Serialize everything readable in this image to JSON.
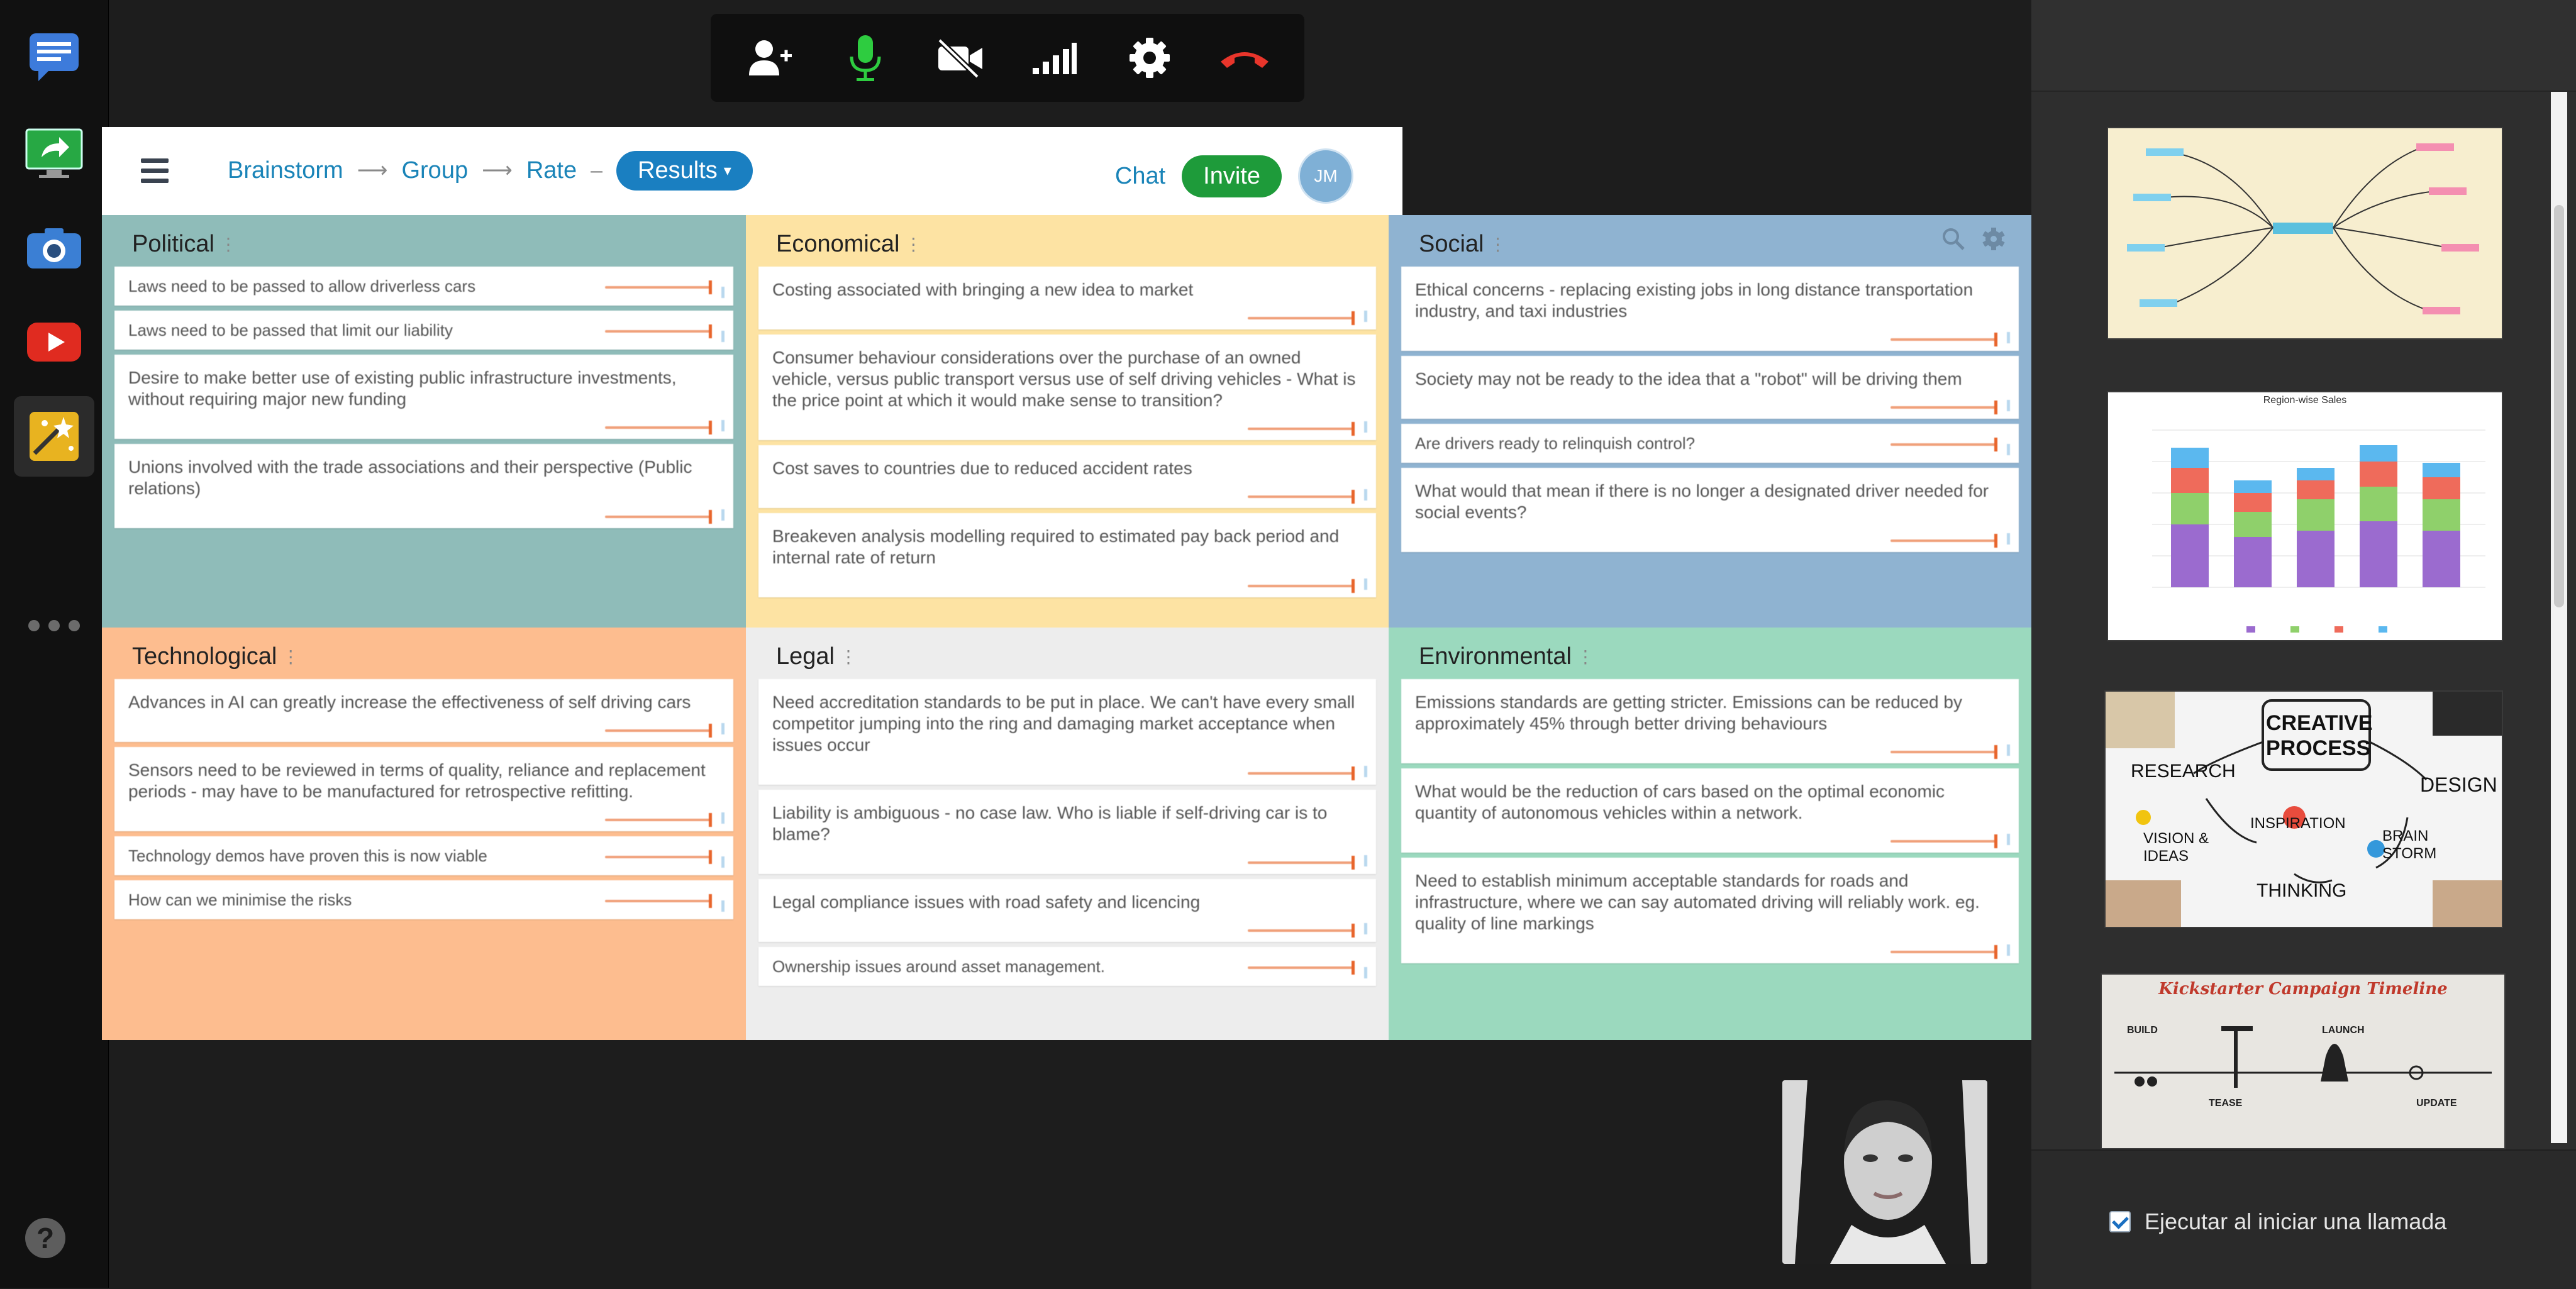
{
  "dock": {
    "items": [
      {
        "name": "chat-icon",
        "color": "#3d7bdb"
      },
      {
        "name": "screen-share-icon",
        "color": "#27a844"
      },
      {
        "name": "camera-icon",
        "color": "#3b7fd4"
      },
      {
        "name": "youtube-icon",
        "color": "#e02b20"
      },
      {
        "name": "photo-effects-icon",
        "color": "#e8b320"
      }
    ],
    "help_label": "?"
  },
  "callbar": {
    "buttons": [
      "add-person-icon",
      "microphone-icon",
      "video-off-icon",
      "signal-icon",
      "settings-icon",
      "hang-up-icon"
    ]
  },
  "header": {
    "breadcrumbs": [
      "Brainstorm",
      "Group",
      "Rate"
    ],
    "active_step": "Results",
    "chat_label": "Chat",
    "invite_label": "Invite",
    "avatar_initials": "JM"
  },
  "categories": [
    {
      "title": "Political",
      "color": "#8fbcb9",
      "cards": [
        {
          "text": "Laws need to be passed to allow driverless cars",
          "size": "small"
        },
        {
          "text": "Laws need to be passed that limit our liability",
          "size": "small"
        },
        {
          "text": "Desire to make better use of existing public infrastructure investments, without requiring major new funding",
          "size": "normal"
        },
        {
          "text": "Unions involved with the trade associations and their perspective (Public relations)",
          "size": "normal"
        }
      ]
    },
    {
      "title": "Economical",
      "color": "#fde3a3",
      "cards": [
        {
          "text": "Costing associated with bringing a new idea to market",
          "size": "normal"
        },
        {
          "text": "Consumer behaviour considerations over the purchase of an owned vehicle, versus public transport versus use of self driving vehicles - What is the price point at which it would make sense to transition?",
          "size": "normal"
        },
        {
          "text": "Cost saves to countries due to reduced accident rates",
          "size": "normal"
        },
        {
          "text": "Breakeven analysis modelling required to estimated pay back period and internal rate of return",
          "size": "normal"
        }
      ]
    },
    {
      "title": "Social",
      "color": "#8fb3d1",
      "cards": [
        {
          "text": "Ethical concerns - replacing existing jobs in long distance transportation industry, and taxi industries",
          "size": "normal"
        },
        {
          "text": "Society may not be ready to the idea that a \"robot\" will be driving them",
          "size": "normal"
        },
        {
          "text": "Are drivers ready to relinquish control?",
          "size": "small"
        },
        {
          "text": "What would that mean if there is no longer a designated driver needed for social events?",
          "size": "normal"
        }
      ]
    },
    {
      "title": "Technological",
      "color": "#fdbd8f",
      "cards": [
        {
          "text": "Advances in AI can greatly increase the effectiveness of self driving cars",
          "size": "normal"
        },
        {
          "text": "Sensors need to be reviewed in terms of quality, reliance and replacement periods - may have to be manufactured for retrospective refitting.",
          "size": "normal"
        },
        {
          "text": "Technology demos have proven this is now viable",
          "size": "small"
        },
        {
          "text": "How can we minimise the risks",
          "size": "small"
        }
      ]
    },
    {
      "title": "Legal",
      "color": "#ededed",
      "cards": [
        {
          "text": "Need accreditation standards to be put in place. We can't have every small competitor jumping into the ring and damaging market acceptance when issues occur",
          "size": "normal"
        },
        {
          "text": "Liability is ambiguous - no case law. Who is liable if self-driving car is to blame?",
          "size": "normal"
        },
        {
          "text": "Legal compliance issues with road safety and licencing",
          "size": "normal"
        },
        {
          "text": "Ownership issues around asset management.",
          "size": "small"
        }
      ]
    },
    {
      "title": "Environmental",
      "color": "#9bd9be",
      "cards": [
        {
          "text": "Emissions standards are getting stricter. Emissions can be reduced by approximately 45% through better driving behaviours",
          "size": "normal"
        },
        {
          "text": "What would be the reduction of cars based on the optimal economic quantity of autonomous vehicles within a network.",
          "size": "normal"
        },
        {
          "text": "Need to establish minimum acceptable standards for roads and infrastructure, where we can say automated driving will reliably work. eg. quality of line markings",
          "size": "normal"
        }
      ]
    }
  ],
  "side_panel": {
    "thumbnails": [
      {
        "kind": "mind-map"
      },
      {
        "kind": "bar-chart",
        "caption": "Region-wise Sales"
      },
      {
        "kind": "collage",
        "words": [
          "CREATIVE PROCESS",
          "RESEARCH",
          "DESIGN",
          "VISION & IDEAS",
          "INSPIRATION",
          "BRAIN STORM",
          "THINKING"
        ]
      },
      {
        "kind": "timeline",
        "title": "Kickstarter Campaign Timeline",
        "words": [
          "BUILD",
          "LAUNCH",
          "TEASE",
          "UPDATE"
        ]
      }
    ],
    "option_label": "Ejecutar al iniciar una llamada",
    "option_checked": true
  }
}
